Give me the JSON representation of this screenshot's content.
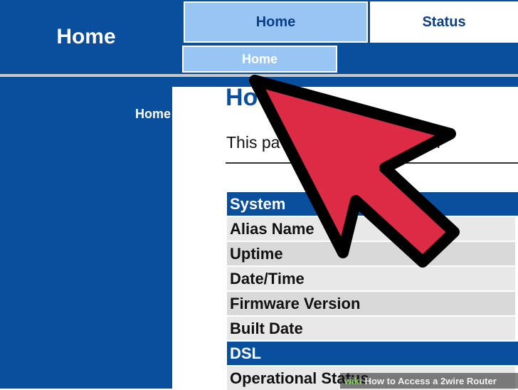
{
  "header": {
    "left_title": "Home",
    "tabs": [
      {
        "label": "Home",
        "active": true
      },
      {
        "label": "Status",
        "active": false
      }
    ],
    "subtabs": [
      {
        "label": "Home"
      }
    ]
  },
  "leftnav": {
    "items": [
      {
        "label": "Home"
      }
    ]
  },
  "main": {
    "title_partial": "Ho",
    "desc_left": "This pa",
    "desc_right": "status an",
    "table": {
      "rows": [
        {
          "label": "System",
          "kind": "section"
        },
        {
          "label": "Alias Name",
          "kind": "odd"
        },
        {
          "label": "Uptime",
          "kind": "even"
        },
        {
          "label": "Date/Time",
          "kind": "odd"
        },
        {
          "label": "Firmware Version",
          "kind": "even"
        },
        {
          "label": "Built Date",
          "kind": "odd"
        },
        {
          "label": "DSL",
          "kind": "section"
        },
        {
          "label": "Operational Status",
          "kind": "odd"
        }
      ]
    }
  },
  "overlay": {
    "caption_logo": "wiki",
    "caption_text": "How to Access a 2wire Router",
    "arrow_color": "#dd2b45"
  },
  "colors": {
    "brand_blue": "#0a4f9e",
    "tab_light": "#99c5f4"
  }
}
